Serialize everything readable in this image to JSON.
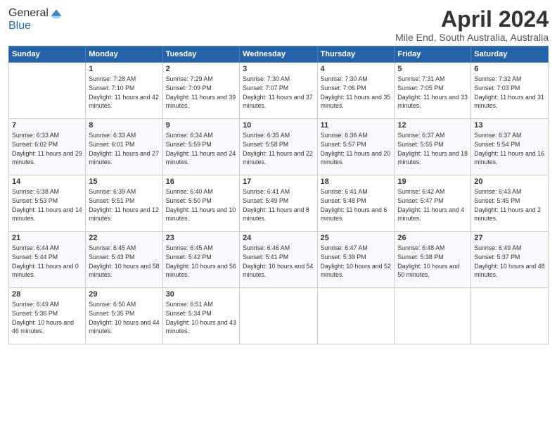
{
  "logo": {
    "line1": "General",
    "line2": "Blue"
  },
  "title": "April 2024",
  "location": "Mile End, South Australia, Australia",
  "weekdays": [
    "Sunday",
    "Monday",
    "Tuesday",
    "Wednesday",
    "Thursday",
    "Friday",
    "Saturday"
  ],
  "weeks": [
    [
      {
        "day": "",
        "sunrise": "",
        "sunset": "",
        "daylight": ""
      },
      {
        "day": "1",
        "sunrise": "Sunrise: 7:28 AM",
        "sunset": "Sunset: 7:10 PM",
        "daylight": "Daylight: 11 hours and 42 minutes."
      },
      {
        "day": "2",
        "sunrise": "Sunrise: 7:29 AM",
        "sunset": "Sunset: 7:09 PM",
        "daylight": "Daylight: 11 hours and 39 minutes."
      },
      {
        "day": "3",
        "sunrise": "Sunrise: 7:30 AM",
        "sunset": "Sunset: 7:07 PM",
        "daylight": "Daylight: 11 hours and 37 minutes."
      },
      {
        "day": "4",
        "sunrise": "Sunrise: 7:30 AM",
        "sunset": "Sunset: 7:06 PM",
        "daylight": "Daylight: 11 hours and 35 minutes."
      },
      {
        "day": "5",
        "sunrise": "Sunrise: 7:31 AM",
        "sunset": "Sunset: 7:05 PM",
        "daylight": "Daylight: 11 hours and 33 minutes."
      },
      {
        "day": "6",
        "sunrise": "Sunrise: 7:32 AM",
        "sunset": "Sunset: 7:03 PM",
        "daylight": "Daylight: 11 hours and 31 minutes."
      }
    ],
    [
      {
        "day": "7",
        "sunrise": "Sunrise: 6:33 AM",
        "sunset": "Sunset: 6:02 PM",
        "daylight": "Daylight: 11 hours and 29 minutes."
      },
      {
        "day": "8",
        "sunrise": "Sunrise: 6:33 AM",
        "sunset": "Sunset: 6:01 PM",
        "daylight": "Daylight: 11 hours and 27 minutes."
      },
      {
        "day": "9",
        "sunrise": "Sunrise: 6:34 AM",
        "sunset": "Sunset: 5:59 PM",
        "daylight": "Daylight: 11 hours and 24 minutes."
      },
      {
        "day": "10",
        "sunrise": "Sunrise: 6:35 AM",
        "sunset": "Sunset: 5:58 PM",
        "daylight": "Daylight: 11 hours and 22 minutes."
      },
      {
        "day": "11",
        "sunrise": "Sunrise: 6:36 AM",
        "sunset": "Sunset: 5:57 PM",
        "daylight": "Daylight: 11 hours and 20 minutes."
      },
      {
        "day": "12",
        "sunrise": "Sunrise: 6:37 AM",
        "sunset": "Sunset: 5:55 PM",
        "daylight": "Daylight: 11 hours and 18 minutes."
      },
      {
        "day": "13",
        "sunrise": "Sunrise: 6:37 AM",
        "sunset": "Sunset: 5:54 PM",
        "daylight": "Daylight: 11 hours and 16 minutes."
      }
    ],
    [
      {
        "day": "14",
        "sunrise": "Sunrise: 6:38 AM",
        "sunset": "Sunset: 5:53 PM",
        "daylight": "Daylight: 11 hours and 14 minutes."
      },
      {
        "day": "15",
        "sunrise": "Sunrise: 6:39 AM",
        "sunset": "Sunset: 5:51 PM",
        "daylight": "Daylight: 11 hours and 12 minutes."
      },
      {
        "day": "16",
        "sunrise": "Sunrise: 6:40 AM",
        "sunset": "Sunset: 5:50 PM",
        "daylight": "Daylight: 11 hours and 10 minutes."
      },
      {
        "day": "17",
        "sunrise": "Sunrise: 6:41 AM",
        "sunset": "Sunset: 5:49 PM",
        "daylight": "Daylight: 11 hours and 8 minutes."
      },
      {
        "day": "18",
        "sunrise": "Sunrise: 6:41 AM",
        "sunset": "Sunset: 5:48 PM",
        "daylight": "Daylight: 11 hours and 6 minutes."
      },
      {
        "day": "19",
        "sunrise": "Sunrise: 6:42 AM",
        "sunset": "Sunset: 5:47 PM",
        "daylight": "Daylight: 11 hours and 4 minutes."
      },
      {
        "day": "20",
        "sunrise": "Sunrise: 6:43 AM",
        "sunset": "Sunset: 5:45 PM",
        "daylight": "Daylight: 11 hours and 2 minutes."
      }
    ],
    [
      {
        "day": "21",
        "sunrise": "Sunrise: 6:44 AM",
        "sunset": "Sunset: 5:44 PM",
        "daylight": "Daylight: 11 hours and 0 minutes."
      },
      {
        "day": "22",
        "sunrise": "Sunrise: 6:45 AM",
        "sunset": "Sunset: 5:43 PM",
        "daylight": "Daylight: 10 hours and 58 minutes."
      },
      {
        "day": "23",
        "sunrise": "Sunrise: 6:45 AM",
        "sunset": "Sunset: 5:42 PM",
        "daylight": "Daylight: 10 hours and 56 minutes."
      },
      {
        "day": "24",
        "sunrise": "Sunrise: 6:46 AM",
        "sunset": "Sunset: 5:41 PM",
        "daylight": "Daylight: 10 hours and 54 minutes."
      },
      {
        "day": "25",
        "sunrise": "Sunrise: 6:47 AM",
        "sunset": "Sunset: 5:39 PM",
        "daylight": "Daylight: 10 hours and 52 minutes."
      },
      {
        "day": "26",
        "sunrise": "Sunrise: 6:48 AM",
        "sunset": "Sunset: 5:38 PM",
        "daylight": "Daylight: 10 hours and 50 minutes."
      },
      {
        "day": "27",
        "sunrise": "Sunrise: 6:49 AM",
        "sunset": "Sunset: 5:37 PM",
        "daylight": "Daylight: 10 hours and 48 minutes."
      }
    ],
    [
      {
        "day": "28",
        "sunrise": "Sunrise: 6:49 AM",
        "sunset": "Sunset: 5:36 PM",
        "daylight": "Daylight: 10 hours and 46 minutes."
      },
      {
        "day": "29",
        "sunrise": "Sunrise: 6:50 AM",
        "sunset": "Sunset: 5:35 PM",
        "daylight": "Daylight: 10 hours and 44 minutes."
      },
      {
        "day": "30",
        "sunrise": "Sunrise: 6:51 AM",
        "sunset": "Sunset: 5:34 PM",
        "daylight": "Daylight: 10 hours and 43 minutes."
      },
      {
        "day": "",
        "sunrise": "",
        "sunset": "",
        "daylight": ""
      },
      {
        "day": "",
        "sunrise": "",
        "sunset": "",
        "daylight": ""
      },
      {
        "day": "",
        "sunrise": "",
        "sunset": "",
        "daylight": ""
      },
      {
        "day": "",
        "sunrise": "",
        "sunset": "",
        "daylight": ""
      }
    ]
  ]
}
